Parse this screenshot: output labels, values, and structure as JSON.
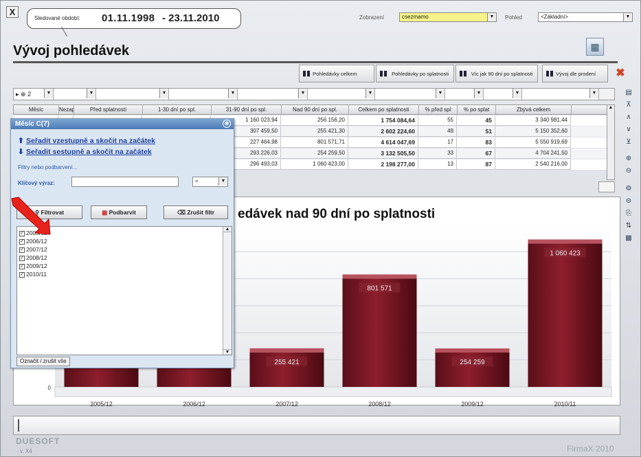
{
  "header": {
    "close_glyph": "X",
    "period_label": "Sledované období:",
    "period_from": "01.11.1998",
    "period_to": "- 23.11.2010",
    "display_label": "Zobrazení",
    "display_value": "csezmamo",
    "view_label": "Pohled",
    "view_value": "<Základní>",
    "page_title": "Vývoj pohledávek"
  },
  "toolbar": {
    "buttons": [
      {
        "label": "Pohledávky celkem"
      },
      {
        "label": "Pohledávky po splatnosti"
      },
      {
        "label": "Víc jak 90 dní po splatnosti"
      },
      {
        "label": "Vývoj dle prodení"
      }
    ]
  },
  "filter_row": {
    "group_value": "2"
  },
  "table": {
    "columns": [
      "Měsíc",
      "Nezapla",
      "Před splatností",
      "1-30 dní po spl.",
      "31-90 dní po spl.",
      "Nad 90 dní po spl.",
      "Celkem po splatnosti",
      "% před spl",
      "% po splat",
      "Zbývá celkem"
    ],
    "rows": [
      {
        "d31": "1 160 023,94",
        "d90": "256 156,20",
        "total": "1 754 084,64",
        "pct_before": "55",
        "pct_after": "45",
        "remaining": "3 340 981,44"
      },
      {
        "d31": "307 459,50",
        "d90": "255 421,30",
        "total": "2 602 224,60",
        "pct_before": "49",
        "pct_after": "51",
        "remaining": "5 150 352,60"
      },
      {
        "d31": "227 464,98",
        "d90": "801 571,71",
        "total": "4 614 047,69",
        "pct_before": "17",
        "pct_after": "83",
        "remaining": "5 550 919,69"
      },
      {
        "d31": "293 226,03",
        "d90": "254 259,50",
        "total": "3 132 505,50",
        "pct_before": "33",
        "pct_after": "67",
        "remaining": "4 704 241,50"
      },
      {
        "d31": "296 493,03",
        "d90": "1 060 423,00",
        "total": "2 198 277,00",
        "pct_before": "13",
        "pct_after": "87",
        "remaining": "2 540 216,00"
      }
    ]
  },
  "popup": {
    "title": "Měsíc C(7)",
    "close_glyph": "⊗",
    "sort_asc": "Seřadit vzestupně a skočit na začátek",
    "sort_desc": "Seřadit sestupně a skočit na začátek",
    "filters_label": "Filtry nebo podbarvení...",
    "keyword_label": "Klíčový výraz:",
    "keyword_value": "",
    "operator_value": "=",
    "filter_button": "Filtrovat",
    "color_button": "Podbarvit",
    "cancel_button": "Zrušit filtr",
    "items": [
      "2005/12",
      "2006/12",
      "2007/12",
      "2008/12",
      "2009/12",
      "2010/11"
    ],
    "mark_all": "Označit / zrušit vše"
  },
  "chart_data": {
    "type": "bar",
    "title": "edávek nad 90 dní po splatnosti",
    "categories": [
      "2005/12",
      "2006/12",
      "2007/12",
      "2008/12",
      "2009/12",
      "2010/11"
    ],
    "values": [
      256156,
      255421,
      255421,
      801571,
      254259,
      1060423
    ],
    "labels": [
      "",
      "",
      "255 421",
      "801 571",
      "254 259",
      "1 060 423"
    ],
    "ylim": [
      0,
      1200000
    ],
    "y_tick_labels": [
      "0"
    ],
    "bar_color": "#8e1e2c",
    "grid": true
  },
  "footer": {
    "logo_text": "DUESOFT",
    "version": "v. X4",
    "brand": "FirmaX 2010"
  }
}
